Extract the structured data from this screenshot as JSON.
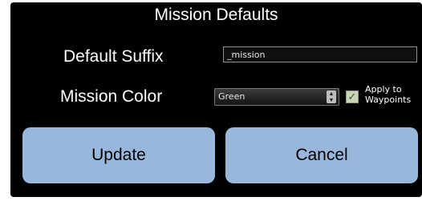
{
  "dialog": {
    "title": "Mission Defaults",
    "suffix_label": "Default Suffix",
    "suffix_value": "_mission",
    "color_label": "Mission Color",
    "color_value": "Green",
    "apply_label_line1": "Apply to",
    "apply_label_line2": "Waypoints",
    "apply_checked": true,
    "update_label": "Update",
    "cancel_label": "Cancel"
  },
  "colors": {
    "background": "#000000",
    "button": "#99b6db",
    "text": "#ffffff"
  },
  "icons": {
    "select_arrows": "updown-arrows-icon",
    "checkbox": "checkmark-icon"
  }
}
